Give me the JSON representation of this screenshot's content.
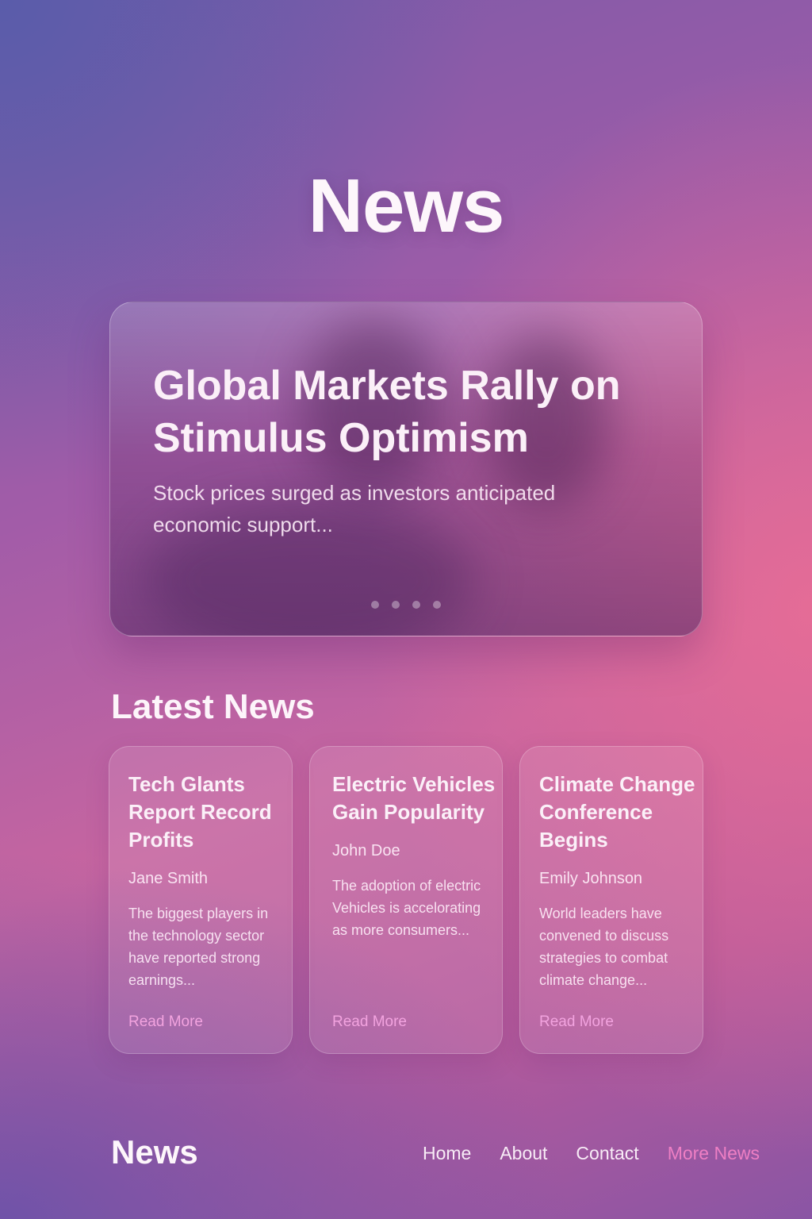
{
  "header": {
    "title": "News"
  },
  "featured": {
    "title": "Global Markets Rally on Stimulus Optimism",
    "summary": "Stock prices surged as investors anticipated economic support...",
    "carousel_dot_count": 4
  },
  "latest": {
    "heading": "Latest News",
    "articles": [
      {
        "title": "Tech Glants Report Record Profits",
        "author": "Jane Smith",
        "excerpt": "The biggest players in the technology sector have reported strong earnings...",
        "link_label": "Read More"
      },
      {
        "title": "Electric Vehicles Gain Popularity",
        "author": "John Doe",
        "excerpt": "The adoption of electric Vehicles is accelorating as more consumers...",
        "link_label": "Read More"
      },
      {
        "title": "Climate Change Conference Begins",
        "author": "Emily Johnson",
        "excerpt": "World leaders have convened to discuss strategies to combat climate change...",
        "link_label": "Read More"
      }
    ]
  },
  "footer": {
    "logo": "News",
    "nav": [
      {
        "label": "Home"
      },
      {
        "label": "About"
      },
      {
        "label": "Contact"
      },
      {
        "label": "More News",
        "active": true
      }
    ]
  },
  "colors": {
    "accent_link": "#ee7fc4",
    "read_more": "#f2a3df"
  }
}
